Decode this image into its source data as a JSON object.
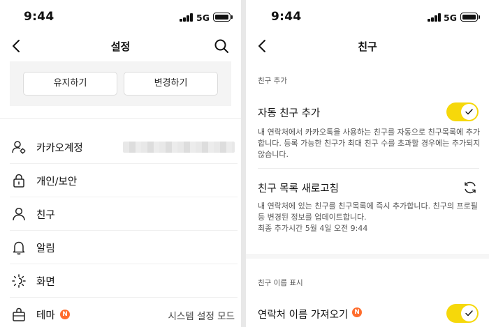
{
  "left": {
    "status": {
      "time": "9:44",
      "network": "5G"
    },
    "header": {
      "title": "설정"
    },
    "buttons": {
      "keep_label": "유지하기",
      "change_label": "변경하기"
    },
    "menu": [
      {
        "label": "카카오계정",
        "icon": "account-icon"
      },
      {
        "label": "개인/보안",
        "icon": "lock-icon"
      },
      {
        "label": "친구",
        "icon": "person-icon"
      },
      {
        "label": "알림",
        "icon": "bell-icon"
      },
      {
        "label": "화면",
        "icon": "brightness-icon"
      },
      {
        "label": "테마",
        "icon": "theme-icon",
        "badge": "N",
        "value": "시스템 설정 모드"
      }
    ]
  },
  "right": {
    "status": {
      "time": "9:44",
      "network": "5G"
    },
    "header": {
      "title": "친구"
    },
    "section_add": "친구 추가",
    "auto_add": {
      "title": "자동 친구 추가",
      "desc": "내 연락처에서 카카오톡을 사용하는 친구를 자동으로 친구목록에 추가합니다. 등록 가능한 친구가 최대 친구 수를 초과할 경우에는 추가되지 않습니다.",
      "enabled": true
    },
    "refresh": {
      "title": "친구 목록 새로고침",
      "desc": "내 연락처에 있는 친구를 친구목록에 즉시 추가합니다. 친구의 프로필 등 변경된 정보를 업데이트합니다.",
      "last": "최종 추가시간 5월 4일 오전 9:44"
    },
    "section_name": "친구 이름 표시",
    "import_name": {
      "title": "연락처 이름 가져오기",
      "badge": "N",
      "enabled": true
    }
  },
  "colors": {
    "accent": "#f6d80a",
    "badge": "#ff6d2d"
  }
}
